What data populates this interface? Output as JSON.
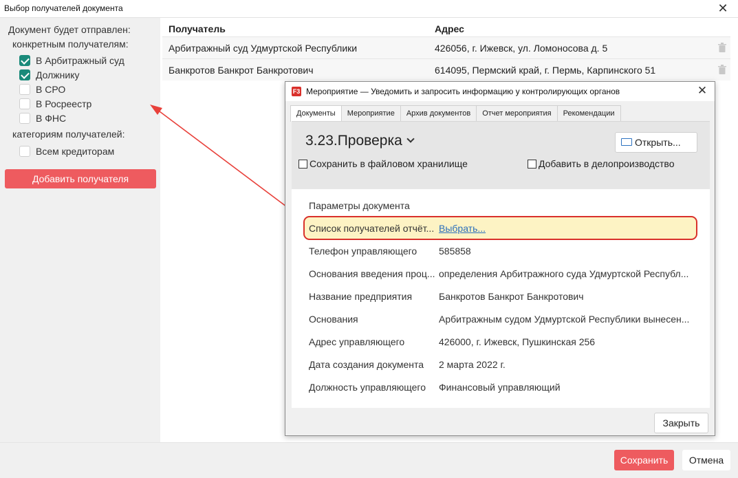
{
  "window": {
    "title": "Выбор получателей документа",
    "close_glyph": "✕"
  },
  "left": {
    "sent_to_label": "Документ будет отправлен:",
    "specific_label": "конкретным получателям:",
    "checkboxes": [
      {
        "label": "В Арбитражный суд",
        "checked": true
      },
      {
        "label": "Должнику",
        "checked": true
      },
      {
        "label": "В СРО",
        "checked": false
      },
      {
        "label": "В Росреестр",
        "checked": false
      },
      {
        "label": "В ФНС",
        "checked": false
      }
    ],
    "category_label": "категориям получателей:",
    "category_checkboxes": [
      {
        "label": "Всем кредиторам",
        "checked": false
      }
    ],
    "add_button": "Добавить получателя"
  },
  "table": {
    "headers": [
      "Получатель",
      "Адрес"
    ],
    "rows": [
      [
        "Арбитражный суд Удмуртской Республики",
        "426056, г. Ижевск, ул. Ломоносова д. 5"
      ],
      [
        "Банкротов Банкрот Банкротович",
        "614095, Пермский край, г. Пермь, Карпинского 51"
      ]
    ]
  },
  "dialog": {
    "logo_text": "F3",
    "title": "Мероприятие — Уведомить и запросить информацию у контролирующих органов",
    "close_glyph": "✕",
    "tabs": [
      {
        "label": "Документы",
        "active": true
      },
      {
        "label": "Мероприятие",
        "active": false
      },
      {
        "label": "Архив документов",
        "active": false
      },
      {
        "label": "Отчет мероприятия",
        "active": false
      },
      {
        "label": "Рекомендации",
        "active": false
      }
    ],
    "document_name": "3.23.Проверка",
    "open_button": "Открыть...",
    "save_in_storage": "Сохранить в файловом хранилище",
    "add_to_records": "Добавить в делопроизводство",
    "params_header": "Параметры документа",
    "params": [
      {
        "label": "Список получателей отчёт...",
        "value": "Выбрать...",
        "link": true
      },
      {
        "label": "Телефон управляющего",
        "value": "585858"
      },
      {
        "label": "Основания  введения проц...",
        "value": "определения Арбитражного суда Удмуртской Республ..."
      },
      {
        "label": "Название предприятия",
        "value": "Банкротов Банкрот Банкротович"
      },
      {
        "label": "Основания",
        "value": "Арбитражным судом Удмуртской Республики вынесен..."
      },
      {
        "label": "Адрес управляющего",
        "value": "426000, г. Ижевск, Пушкинская 256"
      },
      {
        "label": "Дата создания документа",
        "value": "2 марта 2022 г."
      },
      {
        "label": "Должность управляющего",
        "value": "Финансовый управляющий"
      }
    ],
    "close_button": "Закрыть"
  },
  "footer": {
    "save_button": "Сохранить",
    "cancel_button": "Отмена"
  },
  "colors": {
    "accent_red": "#ee5b5f",
    "check_teal": "#1a8a7a",
    "highlight_fill": "#fdf3c4",
    "annotation_red": "#d9302b",
    "link_blue": "#2a6ebb"
  }
}
